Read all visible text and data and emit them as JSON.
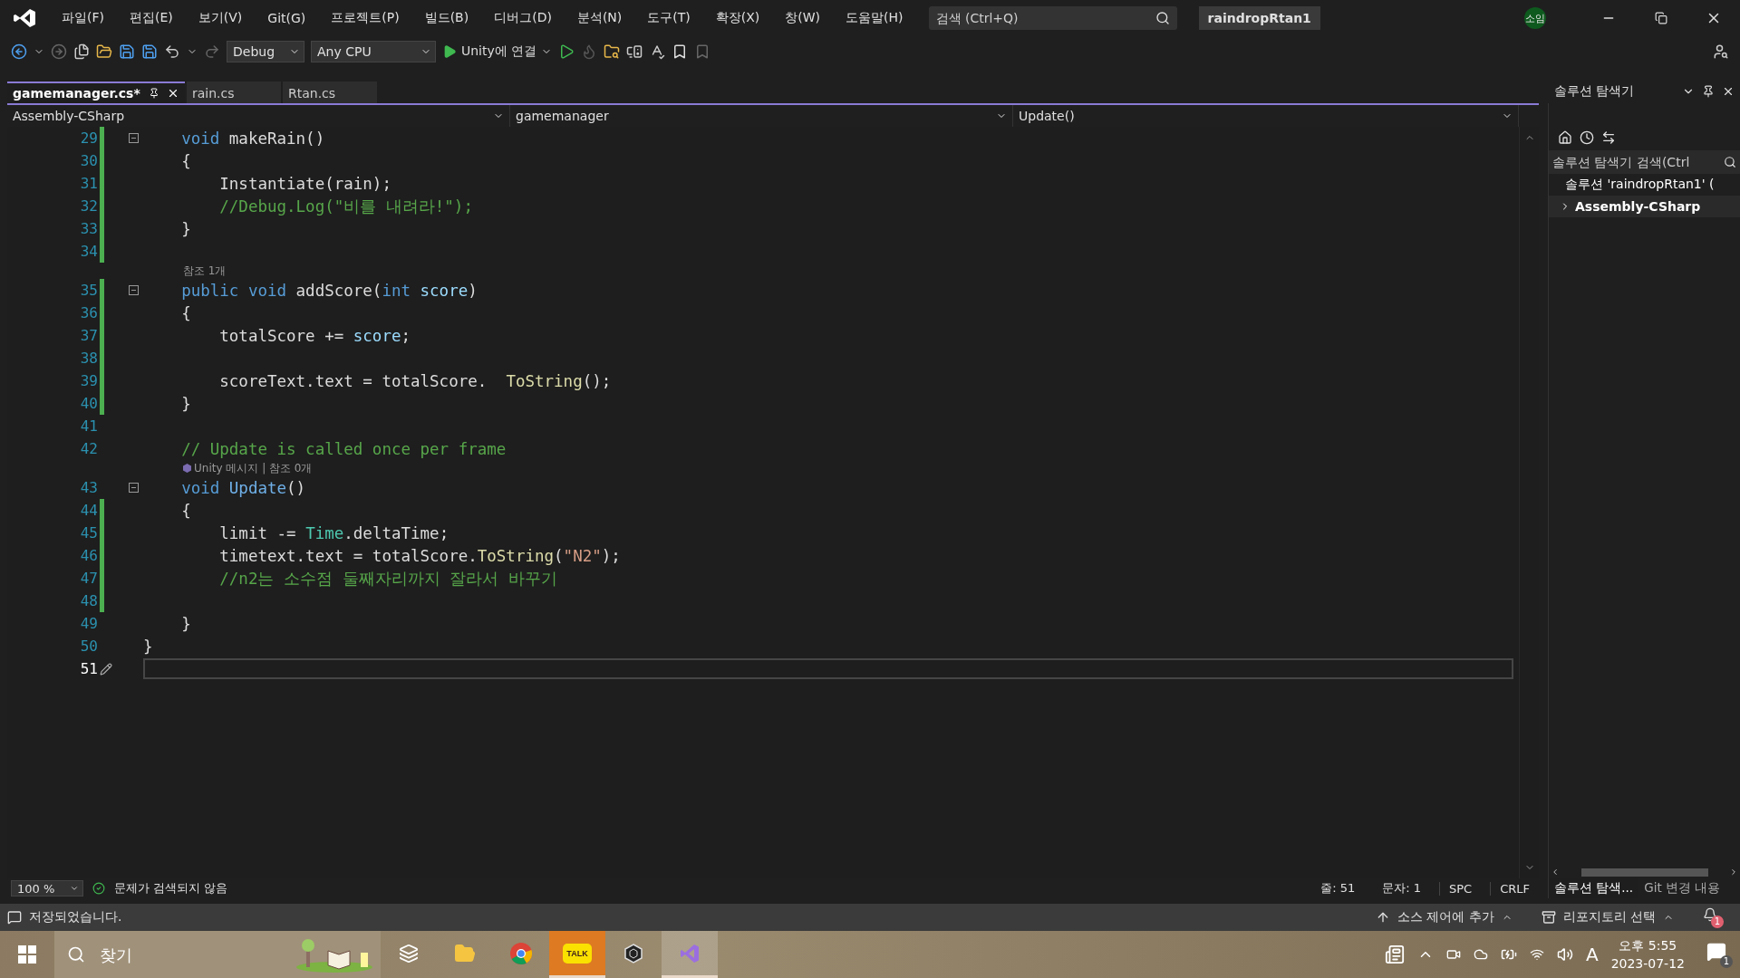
{
  "menu": [
    "파일(F)",
    "편집(E)",
    "보기(V)",
    "Git(G)",
    "프로젝트(P)",
    "빌드(B)",
    "디버그(D)",
    "분석(N)",
    "도구(T)",
    "확장(X)",
    "창(W)",
    "도움말(H)"
  ],
  "search": {
    "placeholder": "검색 (Ctrl+Q)"
  },
  "project_name": "raindropRtan1",
  "avatar": "소임",
  "toolbar": {
    "configuration": "Debug",
    "platform": "Any CPU",
    "run": "Unity에 연결"
  },
  "tabs": [
    {
      "label": "gamemanager.cs*",
      "selected": true
    },
    {
      "label": "rain.cs",
      "selected": false
    },
    {
      "label": "Rtan.cs",
      "selected": false
    }
  ],
  "nav": {
    "project": "Assembly-CSharp",
    "class": "gamemanager",
    "member": "Update()"
  },
  "lines": [
    {
      "kind": "code",
      "number": "29",
      "changed": true,
      "fold": true,
      "current": false,
      "tokens": [
        {
          "kind": "kw",
          "text": "    void"
        },
        {
          "kind": "plain",
          "text": " makeRain()"
        }
      ]
    },
    {
      "kind": "code",
      "number": "30",
      "changed": true,
      "fold": false,
      "current": false,
      "tokens": [
        {
          "kind": "plain",
          "text": "    {"
        }
      ]
    },
    {
      "kind": "code",
      "number": "31",
      "changed": true,
      "fold": false,
      "current": false,
      "tokens": [
        {
          "kind": "plain",
          "text": "        Instantiate(rain);"
        }
      ]
    },
    {
      "kind": "code",
      "number": "32",
      "changed": true,
      "fold": false,
      "current": false,
      "tokens": [
        {
          "kind": "comment",
          "text": "        //Debug.Log(\"비를 내려라!\");"
        }
      ]
    },
    {
      "kind": "code",
      "number": "33",
      "changed": true,
      "fold": false,
      "current": false,
      "tokens": [
        {
          "kind": "plain",
          "text": "    }"
        }
      ]
    },
    {
      "kind": "code",
      "number": "34",
      "changed": true,
      "fold": false,
      "current": false
    },
    {
      "kind": "lens",
      "text": "참조 1개"
    },
    {
      "kind": "code",
      "number": "35",
      "changed": true,
      "fold": true,
      "current": false,
      "tokens": [
        {
          "kind": "kw",
          "text": "    public void"
        },
        {
          "kind": "plain",
          "text": " addScore("
        },
        {
          "kind": "kw",
          "text": "int"
        },
        {
          "kind": "param",
          "text": " score"
        },
        {
          "kind": "plain",
          "text": ")"
        }
      ]
    },
    {
      "kind": "code",
      "number": "36",
      "changed": true,
      "fold": false,
      "current": false,
      "tokens": [
        {
          "kind": "plain",
          "text": "    {"
        }
      ]
    },
    {
      "kind": "code",
      "number": "37",
      "changed": true,
      "fold": false,
      "current": false,
      "tokens": [
        {
          "kind": "plain",
          "text": "        totalScore += "
        },
        {
          "kind": "param",
          "text": "score"
        },
        {
          "kind": "plain",
          "text": ";"
        }
      ]
    },
    {
      "kind": "code",
      "number": "38",
      "changed": true,
      "fold": false,
      "current": false
    },
    {
      "kind": "code",
      "number": "39",
      "changed": true,
      "fold": false,
      "current": false,
      "tokens": [
        {
          "kind": "plain",
          "text": "        scoreText.text = totalScore.  "
        },
        {
          "kind": "method",
          "text": "ToString"
        },
        {
          "kind": "plain",
          "text": "();"
        }
      ]
    },
    {
      "kind": "code",
      "number": "40",
      "changed": true,
      "fold": false,
      "current": false,
      "tokens": [
        {
          "kind": "plain",
          "text": "    }"
        }
      ]
    },
    {
      "kind": "code",
      "number": "41",
      "changed": false,
      "fold": false,
      "current": false
    },
    {
      "kind": "code",
      "number": "42",
      "changed": false,
      "fold": false,
      "current": false,
      "tokens": [
        {
          "kind": "comment",
          "text": "    // Update is called once per frame"
        }
      ]
    },
    {
      "kind": "unity-lens",
      "text": "Unity 메시지 | 참조 0개"
    },
    {
      "kind": "code",
      "number": "43",
      "changed": false,
      "fold": true,
      "current": false,
      "tokens": [
        {
          "kind": "kw",
          "text": "    void"
        },
        {
          "kind": "unity",
          "text": " Update"
        },
        {
          "kind": "plain",
          "text": "()"
        }
      ]
    },
    {
      "kind": "code",
      "number": "44",
      "changed": true,
      "fold": false,
      "current": false,
      "tokens": [
        {
          "kind": "plain",
          "text": "    {"
        }
      ]
    },
    {
      "kind": "code",
      "number": "45",
      "changed": true,
      "fold": false,
      "current": false,
      "tokens": [
        {
          "kind": "plain",
          "text": "        limit -= "
        },
        {
          "kind": "type",
          "text": "Time"
        },
        {
          "kind": "plain",
          "text": ".deltaTime;"
        }
      ]
    },
    {
      "kind": "code",
      "number": "46",
      "changed": true,
      "fold": false,
      "current": false,
      "tokens": [
        {
          "kind": "plain",
          "text": "        timetext.text = totalScore."
        },
        {
          "kind": "method",
          "text": "ToString"
        },
        {
          "kind": "plain",
          "text": "("
        },
        {
          "kind": "string",
          "text": "\"N2\""
        },
        {
          "kind": "plain",
          "text": ");"
        }
      ]
    },
    {
      "kind": "code",
      "number": "47",
      "changed": true,
      "fold": false,
      "current": false,
      "tokens": [
        {
          "kind": "comment",
          "text": "        //n2는 소수점 둘째자리까지 잘라서 바꾸기"
        }
      ]
    },
    {
      "kind": "code",
      "number": "48",
      "changed": true,
      "fold": false,
      "current": false
    },
    {
      "kind": "code",
      "number": "49",
      "changed": false,
      "fold": false,
      "current": false,
      "tokens": [
        {
          "kind": "plain",
          "text": "    }"
        }
      ]
    },
    {
      "kind": "code",
      "number": "50",
      "changed": false,
      "fold": false,
      "current": false,
      "tokens": [
        {
          "kind": "plain",
          "text": "}"
        }
      ]
    },
    {
      "kind": "code",
      "number": "51",
      "changed": false,
      "fold": false,
      "current": true
    }
  ],
  "editor_status": {
    "zoom": "100 %",
    "issues": "문제가 검색되지 않음",
    "line": "줄: 51",
    "column": "문자: 1",
    "whitespace": "SPC",
    "line_ending": "CRLF"
  },
  "solution_explorer": {
    "title": "솔루션 탐색기",
    "search_placeholder": "솔루션 탐색기 검색(Ctrl",
    "tree": [
      {
        "label": "솔루션 'raindropRtan1' (",
        "children": [
          {
            "label": "Assembly-CSharp",
            "expanded": false
          }
        ]
      }
    ],
    "bottom_tabs": [
      {
        "label": "솔루션 탐색...",
        "selected": true
      },
      {
        "label": "Git 변경 내용",
        "selected": false
      }
    ]
  },
  "status_bar": {
    "message": "저장되었습니다.",
    "source_control": "소스 제어에 추가",
    "repository": "리포지토리 선택",
    "notifications": "1"
  },
  "taskbar": {
    "search_placeholder": "찾기",
    "apps": [
      {
        "kind": "task-view",
        "selected": false,
        "attention": false
      },
      {
        "kind": "explorer",
        "selected": false,
        "attention": false
      },
      {
        "kind": "chrome",
        "selected": false,
        "attention": false
      },
      {
        "kind": "talk",
        "label": "TALK",
        "selected": false,
        "attention": true
      },
      {
        "kind": "unity",
        "selected": false,
        "attention": false
      },
      {
        "kind": "visual-studio",
        "selected": true,
        "attention": false
      }
    ],
    "input_method": "A",
    "time": "오후 5:55",
    "date": "2023-07-12",
    "notifications": "1"
  }
}
